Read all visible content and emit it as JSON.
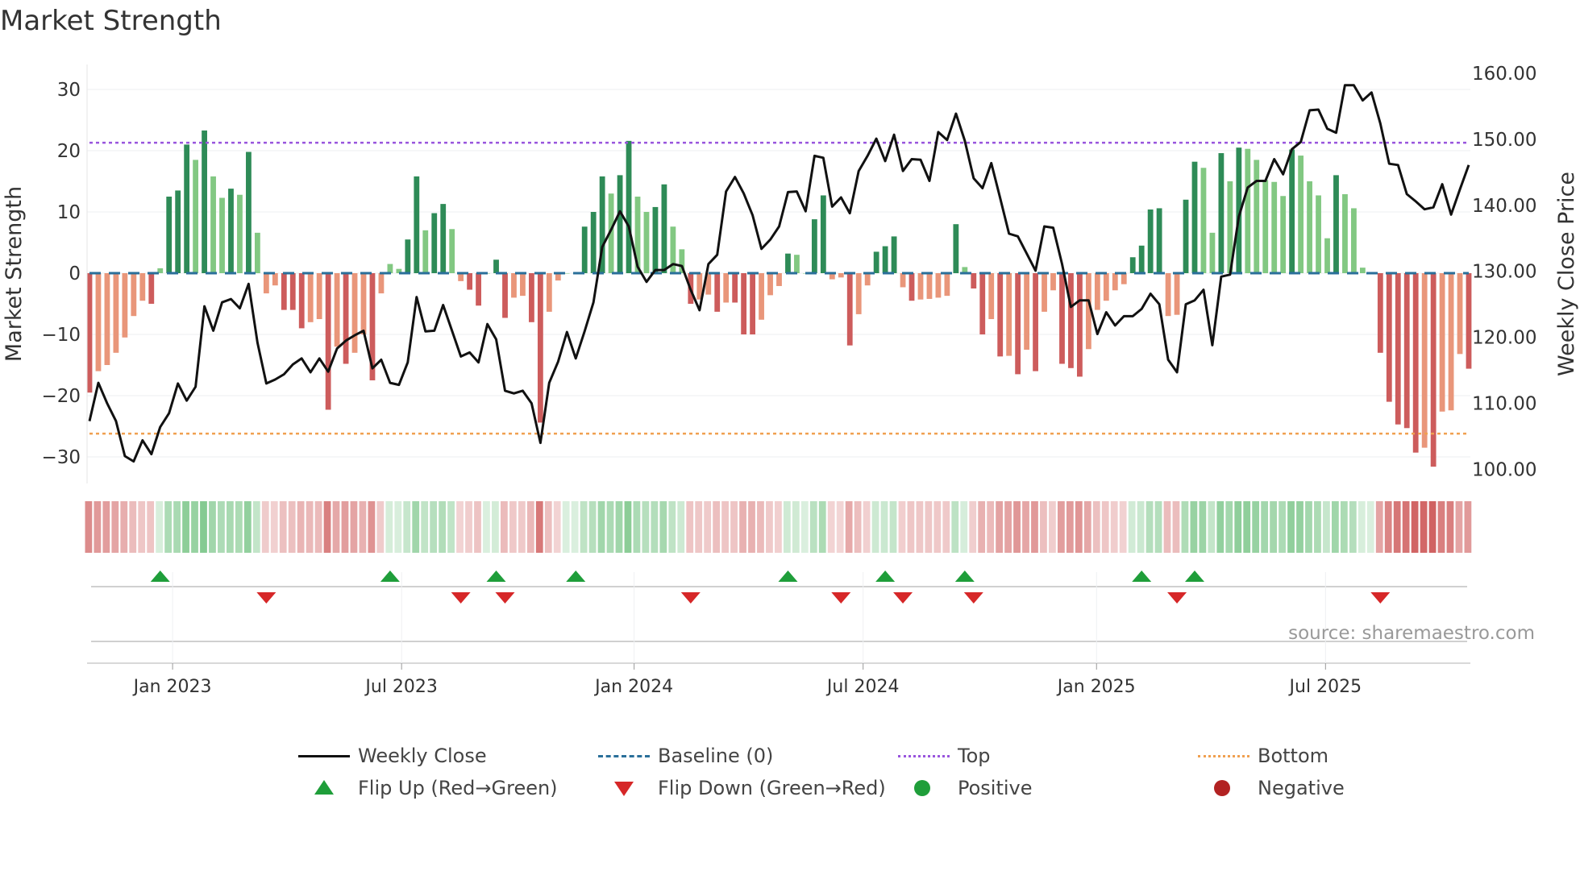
{
  "title": "Market Strength",
  "source": "source: sharemaestro.com",
  "colors": {
    "dark_green": "#2e8b57",
    "light_green": "#82c882",
    "dark_red": "#cd5c5c",
    "light_red": "#e9967a",
    "line": "#111111",
    "top": "#9955dd",
    "bottom": "#f0a050",
    "baseline": "#2a6f9a",
    "flip_up": "#1f9e3a",
    "flip_down": "#d62728"
  },
  "chart_data": {
    "type": "bar",
    "title": "Market Strength",
    "ylabel": "Market Strength",
    "y2label": "Weekly Close Price",
    "ylim": [
      -33,
      33
    ],
    "y2lim": [
      97,
      162
    ],
    "yticks": [
      "30",
      "20",
      "10",
      "0",
      "−10",
      "−20",
      "−30"
    ],
    "ytick_values": [
      30,
      20,
      10,
      0,
      -10,
      -20,
      -30
    ],
    "y2ticks": [
      "160.00",
      "150.00",
      "140.00",
      "130.00",
      "120.00",
      "110.00",
      "100.00"
    ],
    "y2tick_values": [
      160,
      150,
      140,
      130,
      120,
      110,
      100
    ],
    "xticks": [
      "Jan 2023",
      "Jul 2023",
      "Jan 2024",
      "Jul 2024",
      "Jan 2025",
      "Jul 2025"
    ],
    "xtick_weeks": [
      9.4,
      35.3,
      61.6,
      87.5,
      113.9,
      139.8
    ],
    "top": 21.3,
    "bottom": -26.2,
    "strength": [
      -19.5,
      -16,
      -15,
      -13,
      -10.5,
      -7,
      -4.5,
      -5,
      0.8,
      12.5,
      13.5,
      21,
      18.5,
      23.3,
      15.8,
      12.3,
      13.8,
      12.8,
      19.8,
      6.6,
      -3.3,
      -2,
      -6,
      -6,
      -9,
      -8,
      -7.5,
      -22.3,
      -12,
      -14.8,
      -13,
      -10,
      -17.5,
      -3.3,
      1.5,
      0.7,
      5.5,
      15.8,
      7,
      9.8,
      11.3,
      7.2,
      -1.3,
      -2.7,
      -5.3,
      0,
      2.2,
      -7.3,
      -4,
      -3.7,
      -8,
      -24.4,
      -6.3,
      -1.2,
      0,
      0,
      7.6,
      10,
      15.8,
      13,
      16,
      21.6,
      12.5,
      10,
      10.8,
      14.5,
      7.6,
      3.9,
      -5,
      -4.3,
      -3.5,
      -6.3,
      -4.8,
      -4.8,
      -10,
      -10,
      -7.6,
      -3.6,
      -2.1,
      3.2,
      3,
      0,
      8.8,
      12.7,
      -1,
      -0.7,
      -11.8,
      -6.7,
      -2,
      3.5,
      4.4,
      6,
      -2.3,
      -4.5,
      -4.3,
      -4.2,
      -4,
      -3.7,
      8,
      1,
      -2.5,
      -10,
      -7.5,
      -13.6,
      -13.5,
      -16.5,
      -12.5,
      -16,
      -6.3,
      -2.8,
      -14.8,
      -15.5,
      -16.9,
      -12.4,
      -6,
      -4.5,
      -2.8,
      -1.8,
      2.6,
      4.5,
      10.4,
      10.6,
      -7,
      -6.8,
      12,
      18.2,
      17.2,
      6.6,
      19.6,
      15,
      20.5,
      20.3,
      18.5,
      15.2,
      14.9,
      12.6,
      20.2,
      19.2,
      15,
      12.7,
      5.7,
      16,
      12.9,
      10.6,
      0.9,
      0,
      -13,
      -21,
      -24.7,
      -25.3,
      -29.3,
      -28.5,
      -31.6,
      -22.6,
      -22.4,
      -13.2,
      -15.6
    ],
    "weekly_close": [
      107.3,
      113.1,
      110,
      107.3,
      102,
      101.2,
      104.4,
      102.3,
      106.4,
      108.5,
      113,
      110.4,
      112.5,
      124.7,
      121,
      125.3,
      125.8,
      124.4,
      128.1,
      119.2,
      113,
      113.6,
      114.4,
      115.9,
      116.8,
      114.7,
      116.8,
      114.8,
      118.3,
      119.5,
      120.3,
      121,
      115.3,
      116.6,
      113.1,
      112.8,
      116.2,
      126.1,
      120.9,
      121,
      124.9,
      121,
      117.1,
      117.7,
      116.2,
      122,
      119.7,
      111.9,
      111.5,
      111.9,
      110,
      104,
      113.1,
      116.3,
      120.8,
      116.8,
      120.9,
      125.3,
      133.7,
      136.3,
      139.1,
      136.8,
      130.7,
      128.4,
      130.2,
      130.2,
      131.1,
      130.8,
      127.2,
      124.1,
      131.1,
      132.5,
      142.1,
      144.3,
      141.8,
      138.5,
      133.4,
      134.8,
      136.8,
      142,
      142.1,
      139.1,
      147.5,
      147.2,
      139.8,
      141.2,
      138.8,
      145.2,
      147.5,
      150.1,
      146.7,
      150.7,
      145.2,
      147,
      146.9,
      143.7,
      151.1,
      149.9,
      153.9,
      149.8,
      144.1,
      142.6,
      146.4,
      141.1,
      135.7,
      135.3,
      132.7,
      130.1,
      136.8,
      136.6,
      131.1,
      124.6,
      125.6,
      125.6,
      120.5,
      123.8,
      121.8,
      123.2,
      123.2,
      124.3,
      126.6,
      125,
      116.6,
      114.7,
      125,
      125.6,
      127.2,
      118.8,
      129.2,
      129.5,
      138.3,
      142.7,
      143.7,
      143.7,
      147,
      144.7,
      148.5,
      149.6,
      154.4,
      154.5,
      151.6,
      151,
      158.2,
      158.2,
      155.9,
      157.1,
      152.4,
      146.3,
      146.1,
      141.7,
      140.6,
      139.4,
      139.7,
      143.2,
      138.6,
      142.4,
      146.1
    ],
    "flip_up_weeks": [
      8,
      34,
      46,
      55,
      79,
      90,
      99,
      119,
      125
    ],
    "flip_down_weeks": [
      20,
      42,
      47,
      68,
      85,
      92,
      100,
      123,
      146
    ],
    "legend": {
      "weekly_close": "Weekly Close",
      "baseline": "Baseline (0)",
      "top": "Top",
      "bottom": "Bottom",
      "flip_up": "Flip Up (Red→Green)",
      "flip_down": "Flip Down (Green→Red)",
      "positive": "Positive",
      "negative": "Negative"
    },
    "legend_position": "bottom"
  }
}
